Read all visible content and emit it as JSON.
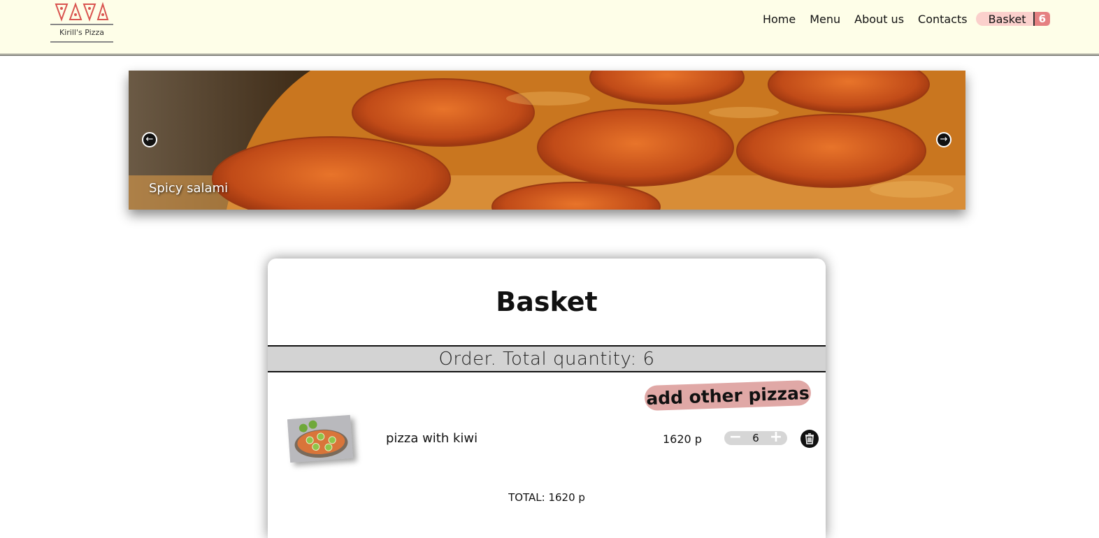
{
  "header": {
    "logo_text": "Kirill's Pizza",
    "nav": [
      "Home",
      "Menu",
      "About us",
      "Contacts"
    ],
    "basket_label": "Basket",
    "basket_count": "6"
  },
  "slider": {
    "caption": "Spicy salami",
    "prev_icon": "arrow-left-icon",
    "next_icon": "arrow-right-icon"
  },
  "basket": {
    "title": "Basket",
    "order_summary": "Order. Total quantity: 6",
    "add_button": "add other pizzas",
    "items": [
      {
        "name": "pizza with kiwi",
        "price": "1620 р",
        "quantity": "6",
        "minus": "−",
        "plus": "+"
      }
    ],
    "total": "TOTAL: 1620 р"
  },
  "colors": {
    "header_bg": "#fefee8",
    "accent_pink": "#e0a8a6",
    "basket_badge": "#e58081",
    "order_bar": "#d3d3d3"
  }
}
